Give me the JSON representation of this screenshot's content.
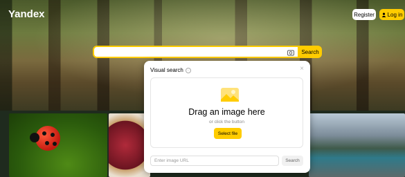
{
  "header": {
    "logo": "Yandex",
    "register_label": "Register",
    "login_label": "Log in",
    "login_icon": "user-icon"
  },
  "search": {
    "button_label": "Search",
    "camera_icon": "camera-icon",
    "accent_color": "#ffcc00"
  },
  "visual_search": {
    "title": "Visual search",
    "drag_text": "Drag an image here",
    "or_text": "or click the button",
    "select_label": "Select file",
    "url_placeholder": "Enter image URL",
    "url_search_label": "Search"
  },
  "gallery": {
    "items": [
      "ladybug",
      "berry-tart",
      "mountain-lake"
    ]
  }
}
